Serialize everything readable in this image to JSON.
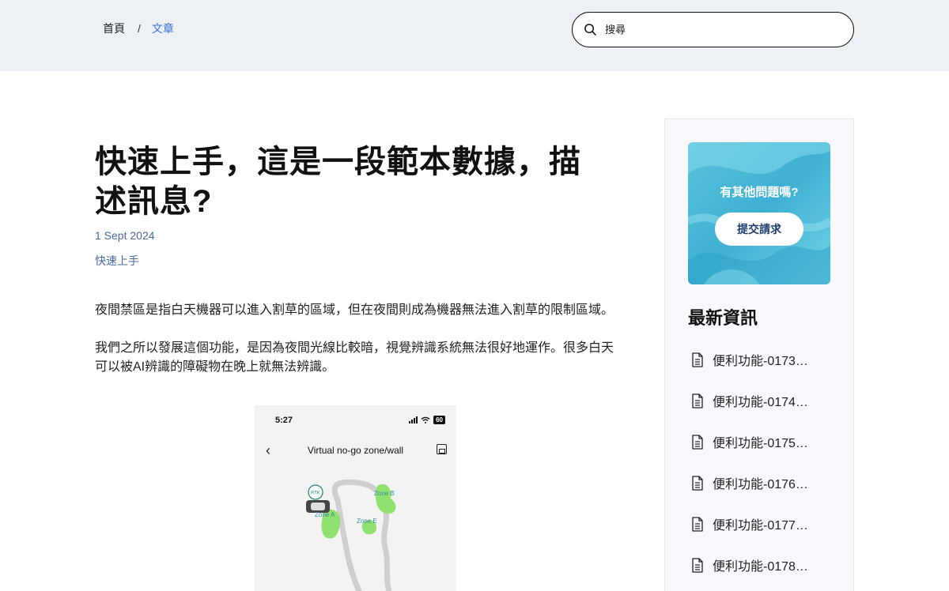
{
  "header": {
    "breadcrumb": {
      "home": "首頁",
      "separator": "/",
      "current": "文章"
    },
    "search": {
      "placeholder": "搜尋"
    }
  },
  "article": {
    "title": "快速上手，這是一段範本數據，描述訊息?",
    "date": "1 Sept 2024",
    "category": "快速上手",
    "paragraphs": [
      "夜間禁區是指白天機器可以進入割草的區域，但在夜間則成為機器無法進入割草的限制區域。",
      "我們之所以發展這個功能，是因為夜間光線比較暗，視覺辨識系統無法很好地運作。很多白天可以被AI辨識的障礙物在晚上就無法辨識。"
    ],
    "screenshot": {
      "time": "5:27",
      "battery": "60",
      "title": "Virtual no-go zone/wall",
      "rtk_label": "RTK",
      "zones": [
        "Zone A",
        "Zone B",
        "Zone E"
      ]
    }
  },
  "sidebar": {
    "promo": {
      "question": "有其他問題嗎?",
      "button": "提交請求"
    },
    "news_title": "最新資訊",
    "news": [
      "便利功能-0173…",
      "便利功能-0174…",
      "便利功能-0175…",
      "便利功能-0176…",
      "便利功能-0177…",
      "便利功能-0178…"
    ]
  },
  "colors": {
    "header_bg": "#edf1f6",
    "link": "#3b6fd6",
    "meta": "#4a6aa0",
    "promo_bg": "#4ab9d8",
    "zone_green": "#8fe26f"
  }
}
